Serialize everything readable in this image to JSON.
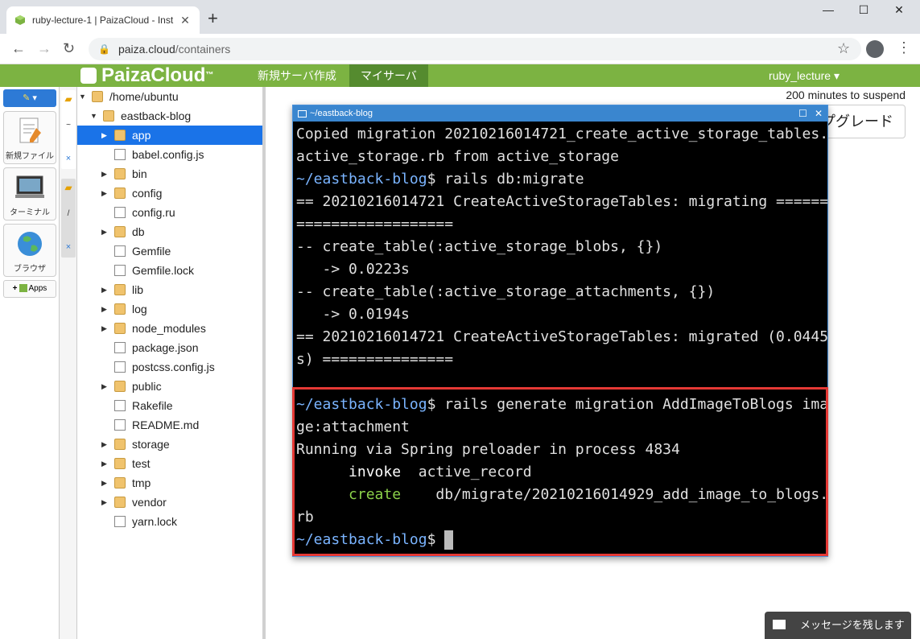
{
  "browser": {
    "tab_title": "ruby-lecture-1 | PaizaCloud - Inst",
    "tab_close": "✕",
    "new_tab": "+",
    "url_domain": "paiza.cloud",
    "url_path": "/containers",
    "win_min": "—",
    "win_max": "☐",
    "win_close": "✕"
  },
  "header": {
    "logo": "PaizaCloud",
    "logo_tm": "™",
    "nav": [
      "新規サーバ作成",
      "マイサーバ"
    ],
    "user": "ruby_lecture ▾"
  },
  "tools": {
    "dropdown": "▾",
    "items": [
      {
        "label": "新規ファイル",
        "icon": "new-file-icon"
      },
      {
        "label": "ターミナル",
        "icon": "terminal-icon"
      },
      {
        "label": "ブラウザ",
        "icon": "browser-globe-icon"
      }
    ],
    "apps": "Apps"
  },
  "vertical_tabs": [
    {
      "label": "~",
      "close": "×"
    },
    {
      "label": "/",
      "close": "×"
    }
  ],
  "tree": [
    {
      "label": "/home/ubuntu",
      "type": "folder",
      "depth": 0,
      "expanded": true
    },
    {
      "label": "eastback-blog",
      "type": "folder",
      "depth": 1,
      "expanded": true
    },
    {
      "label": "app",
      "type": "folder",
      "depth": 2,
      "collapsed": true,
      "selected": true
    },
    {
      "label": "babel.config.js",
      "type": "file",
      "depth": 2
    },
    {
      "label": "bin",
      "type": "folder",
      "depth": 2,
      "collapsed": true
    },
    {
      "label": "config",
      "type": "folder",
      "depth": 2,
      "collapsed": true
    },
    {
      "label": "config.ru",
      "type": "file",
      "depth": 2
    },
    {
      "label": "db",
      "type": "folder",
      "depth": 2,
      "collapsed": true
    },
    {
      "label": "Gemfile",
      "type": "file",
      "depth": 2
    },
    {
      "label": "Gemfile.lock",
      "type": "file",
      "depth": 2
    },
    {
      "label": "lib",
      "type": "folder",
      "depth": 2,
      "collapsed": true
    },
    {
      "label": "log",
      "type": "folder",
      "depth": 2,
      "collapsed": true
    },
    {
      "label": "node_modules",
      "type": "folder",
      "depth": 2,
      "collapsed": true
    },
    {
      "label": "package.json",
      "type": "file",
      "depth": 2
    },
    {
      "label": "postcss.config.js",
      "type": "file",
      "depth": 2
    },
    {
      "label": "public",
      "type": "folder",
      "depth": 2,
      "collapsed": true
    },
    {
      "label": "Rakefile",
      "type": "file",
      "depth": 2
    },
    {
      "label": "README.md",
      "type": "file",
      "depth": 2
    },
    {
      "label": "storage",
      "type": "folder",
      "depth": 2,
      "collapsed": true
    },
    {
      "label": "test",
      "type": "folder",
      "depth": 2,
      "collapsed": true
    },
    {
      "label": "tmp",
      "type": "folder",
      "depth": 2,
      "collapsed": true
    },
    {
      "label": "vendor",
      "type": "folder",
      "depth": 2,
      "collapsed": true
    },
    {
      "label": "yarn.lock",
      "type": "file",
      "depth": 2
    }
  ],
  "main": {
    "suspend": "200 minutes to suspend",
    "upgrade": "プグレード"
  },
  "terminal": {
    "title": "~/eastback-blog",
    "btn_max": "☐",
    "btn_close": "✕",
    "lines": [
      [
        {
          "t": "Copied migration 20210216014721_create_active_storage_tables.",
          "c": ""
        }
      ],
      [
        {
          "t": "active_storage.rb from active_storage",
          "c": ""
        }
      ],
      [
        {
          "t": "~/eastback-blog",
          "c": "prompt"
        },
        {
          "t": "$ rails db:migrate",
          "c": ""
        }
      ],
      [
        {
          "t": "== 20210216014721 CreateActiveStorageTables: migrating ======",
          "c": ""
        }
      ],
      [
        {
          "t": "==================",
          "c": ""
        }
      ],
      [
        {
          "t": "-- create_table(:active_storage_blobs, {})",
          "c": ""
        }
      ],
      [
        {
          "t": "   -> 0.0223s",
          "c": ""
        }
      ],
      [
        {
          "t": "-- create_table(:active_storage_attachments, {})",
          "c": ""
        }
      ],
      [
        {
          "t": "   -> 0.0194s",
          "c": ""
        }
      ],
      [
        {
          "t": "== 20210216014721 CreateActiveStorageTables: migrated (0.0445",
          "c": ""
        }
      ],
      [
        {
          "t": "s) ===============",
          "c": ""
        }
      ],
      [
        {
          "t": "",
          "c": ""
        }
      ],
      [
        {
          "t": "~/eastback-blog",
          "c": "prompt"
        },
        {
          "t": "$ rails generate migration AddImageToBlogs ima",
          "c": ""
        }
      ],
      [
        {
          "t": "ge:attachment",
          "c": ""
        }
      ],
      [
        {
          "t": "Running via Spring preloader in process 4834",
          "c": ""
        }
      ],
      [
        {
          "t": "      ",
          "c": ""
        },
        {
          "t": "invoke",
          "c": "c-white"
        },
        {
          "t": "  active_record",
          "c": ""
        }
      ],
      [
        {
          "t": "      ",
          "c": ""
        },
        {
          "t": "create",
          "c": "c-green"
        },
        {
          "t": "    db/migrate/20210216014929_add_image_to_blogs.",
          "c": ""
        }
      ],
      [
        {
          "t": "rb",
          "c": ""
        }
      ],
      [
        {
          "t": "~/eastback-blog",
          "c": "prompt"
        },
        {
          "t": "$ ",
          "c": ""
        }
      ]
    ]
  },
  "message": {
    "label": "メッセージを残します"
  },
  "colors": {
    "accent_green": "#7cb342",
    "active_nav": "#558b2f",
    "terminal_title": "#3a86cf",
    "highlight_red": "#e53935",
    "prompt_blue": "#7ab4ff",
    "selected_row": "#1a73e8"
  }
}
